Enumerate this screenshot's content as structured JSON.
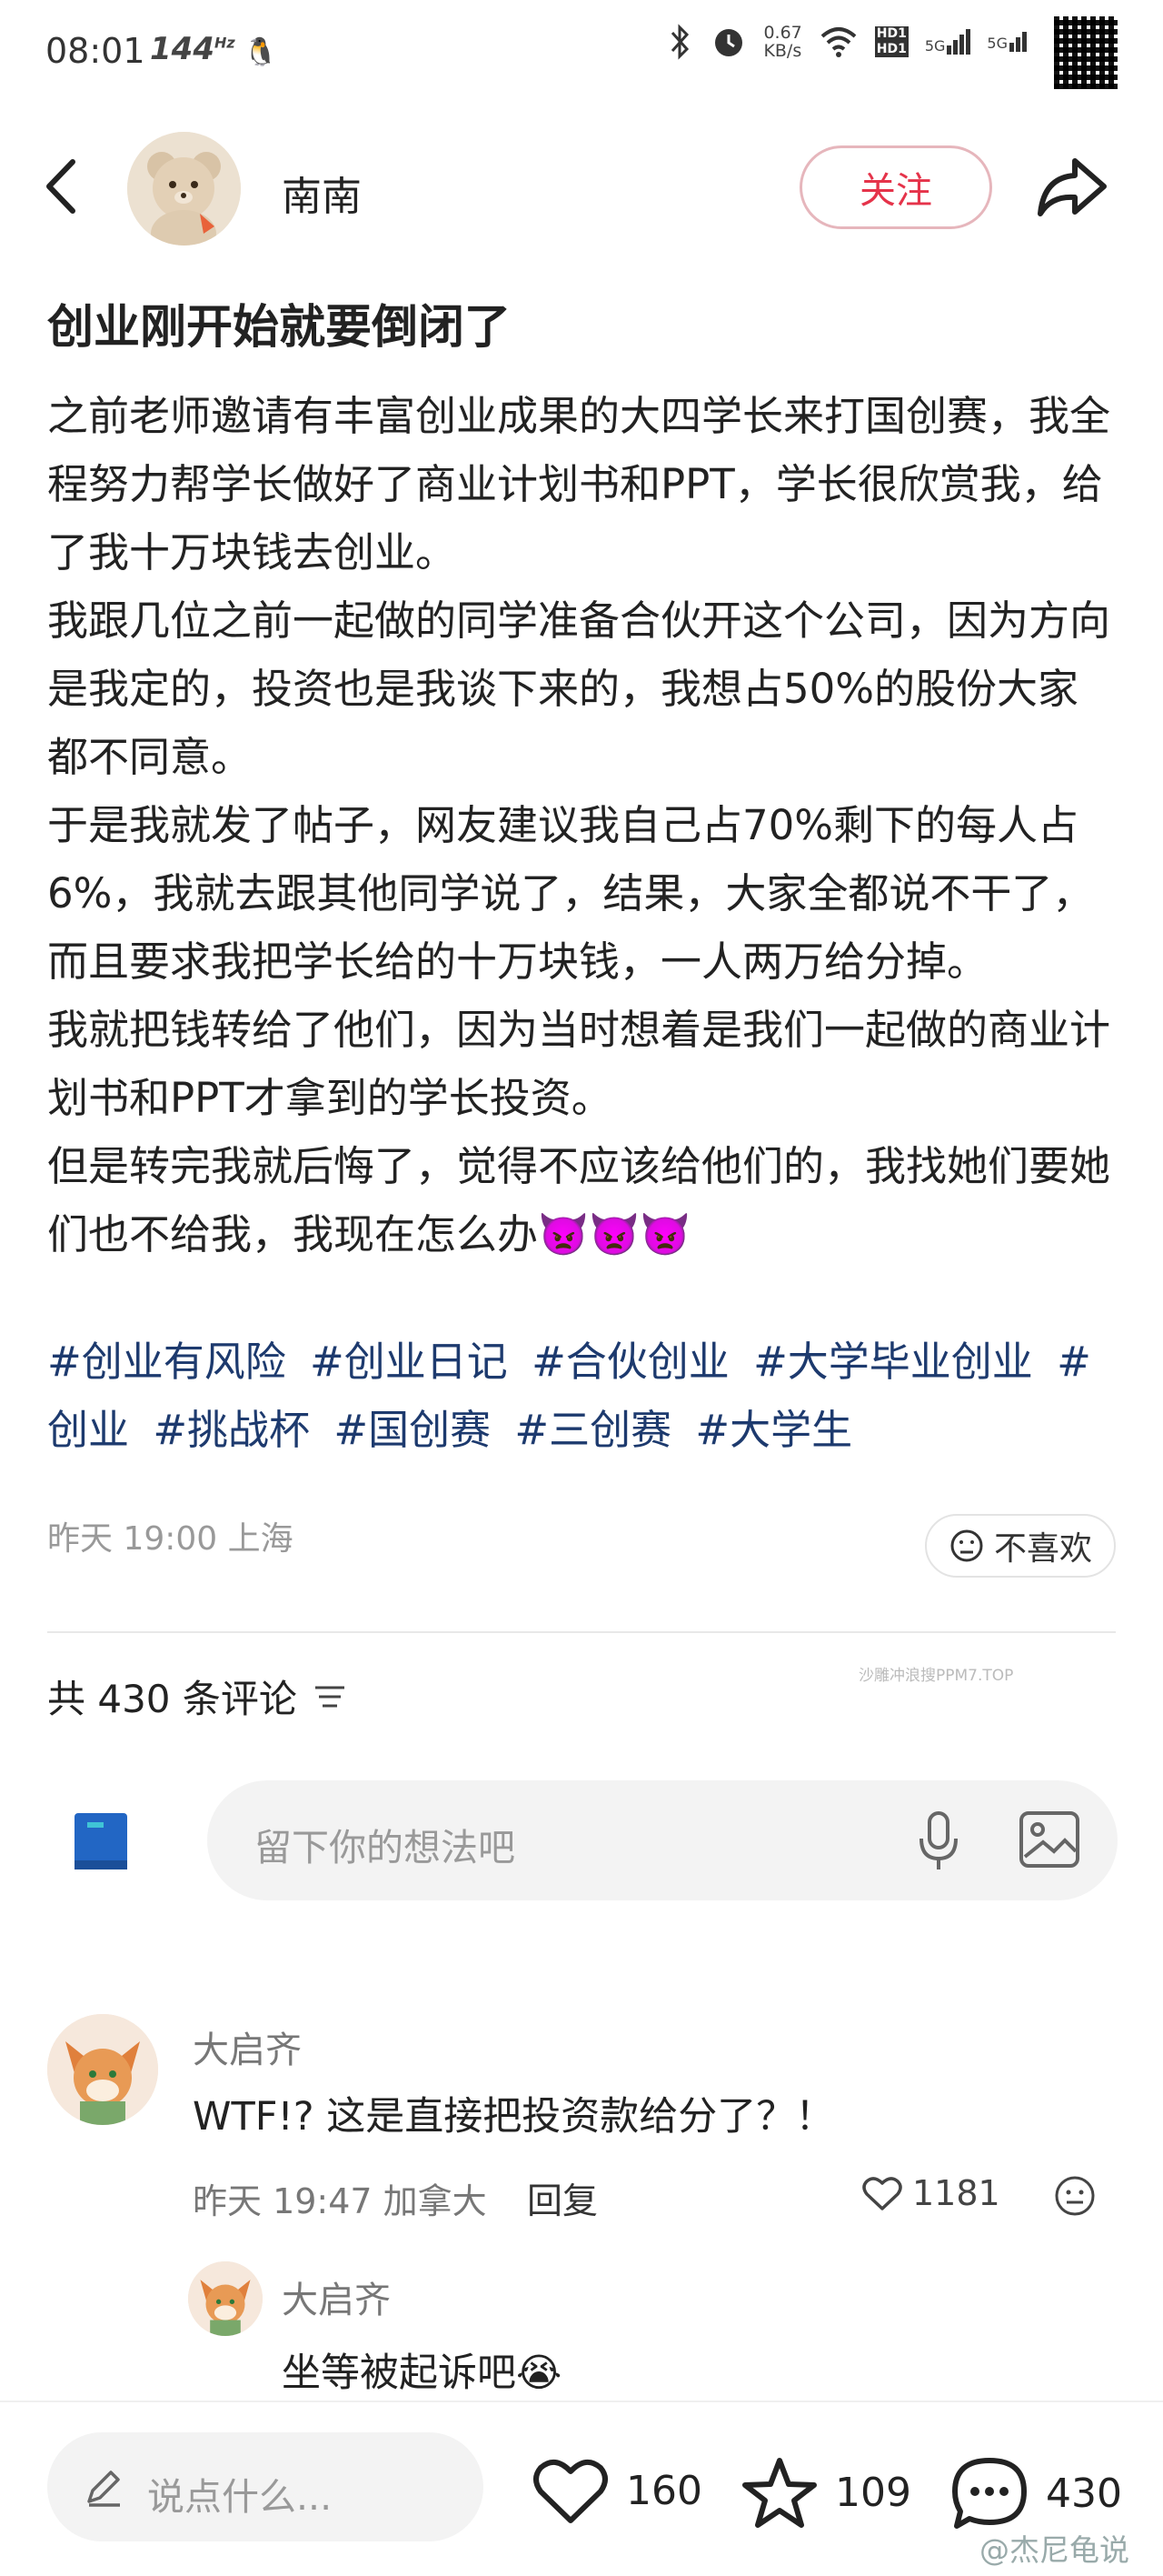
{
  "status_bar": {
    "time": "08:01",
    "refresh_rate": "144",
    "refresh_unit": "Hz",
    "net_speed": "0.67",
    "net_speed_unit": "KB/s",
    "signal_1": "5G",
    "signal_2": "5G",
    "hd_1": "HD1",
    "hd_2": "HD1"
  },
  "header": {
    "author_name": "南南",
    "follow_label": "关注"
  },
  "post": {
    "title": "创业刚开始就要倒闭了",
    "paragraphs": [
      "之前老师邀请有丰富创业成果的大四学长来打国创赛，我全程努力帮学长做好了商业计划书和PPT，学长很欣赏我，给了我十万块钱去创业。",
      "我跟几位之前一起做的同学准备合伙开这个公司，因为方向是我定的，投资也是我谈下来的，我想占50%的股份大家都不同意。",
      "于是我就发了帖子，网友建议我自己占70%剩下的每人占6%，我就去跟其他同学说了，结果，大家全都说不干了，而且要求我把学长给的十万块钱，一人两万给分掉。",
      "我就把钱转给了他们，因为当时想着是我们一起做的商业计划书和PPT才拿到的学长投资。",
      "但是转完我就后悔了，觉得不应该给他们的，我找她们要她们也不给我，我现在怎么办👿👿👿"
    ],
    "tags": [
      "#创业有风险",
      "#创业日记",
      "#合伙创业",
      "#大学毕业创业",
      "#创业",
      "#挑战杯",
      "#国创赛",
      "#三创赛",
      "#大学生"
    ],
    "meta": "昨天 19:00 上海",
    "dislike_label": "不喜欢"
  },
  "comments_section": {
    "watermark": "沙雕冲浪搜PPM7.TOP",
    "header": "共 430 条评论",
    "input_placeholder": "留下你的想法吧",
    "comments": [
      {
        "author": "大启齐",
        "text": "WTF!? 这是直接把投资款给分了？！",
        "meta": "昨天 19:47 加拿大",
        "reply_label": "回复",
        "likes": "1181"
      },
      {
        "author": "大启齐",
        "text": "坐等被起诉吧😭"
      }
    ]
  },
  "bottom_bar": {
    "say_placeholder": "说点什么...",
    "like_count": "160",
    "fav_count": "109",
    "comment_count": "430",
    "weibo_watermark": "@杰尼龟说"
  },
  "colors": {
    "accent_red": "#e5334a",
    "tag_blue": "#1d3a6e",
    "muted_gray": "#999999"
  },
  "icons": [
    "back-arrow-icon",
    "share-icon",
    "neutral-face-icon",
    "sort-icon",
    "book-icon",
    "mic-icon",
    "image-icon",
    "heart-icon",
    "smiley-icon",
    "pen-icon",
    "star-icon",
    "chat-bubble-icon",
    "bluetooth-icon",
    "alarm-icon",
    "wifi-icon",
    "battery-icon",
    "qr-code-icon"
  ]
}
